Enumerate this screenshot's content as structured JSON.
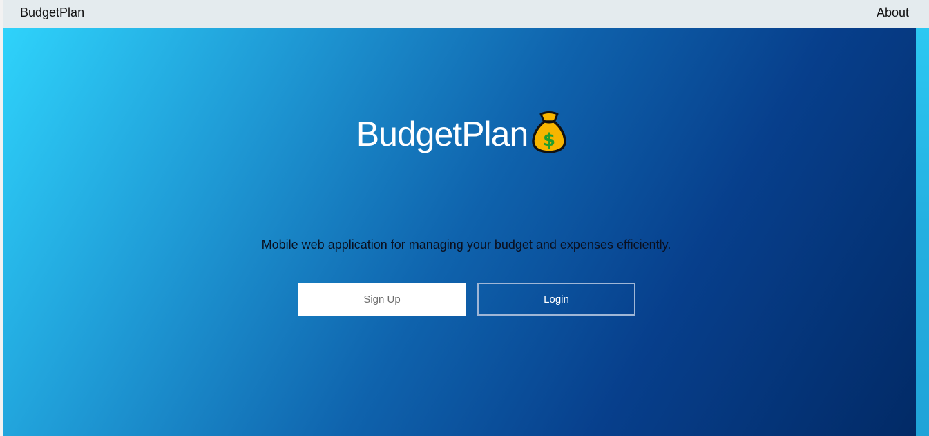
{
  "navbar": {
    "brand": "BudgetPlan",
    "about_link": "About"
  },
  "hero": {
    "title": "BudgetPlan",
    "title_icon": "money-bag-icon",
    "tagline": "Mobile web application for managing your budget and expenses efficiently.",
    "signup_label": "Sign Up",
    "login_label": "Login"
  },
  "colors": {
    "navbar_bg": "#e4ebee",
    "gradient_start": "#2fd3fb",
    "gradient_end": "#022a66",
    "signup_bg": "#ffffff",
    "login_border": "#9fb6d6"
  }
}
